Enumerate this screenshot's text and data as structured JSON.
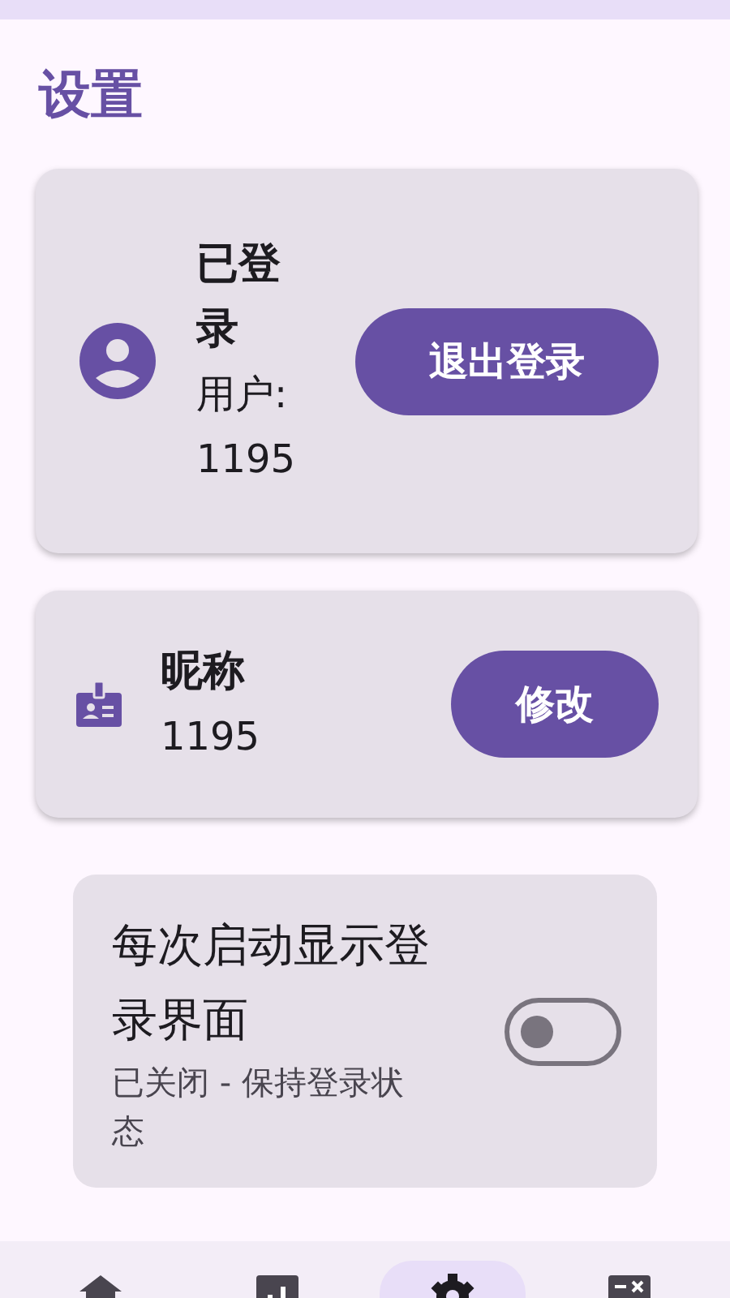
{
  "page": {
    "title": "设置"
  },
  "account": {
    "status": "已登录",
    "user": "用户: 1195",
    "button": "退出登录"
  },
  "nickname": {
    "label": "昵称",
    "value": "1195",
    "button": "修改"
  },
  "login_screen": {
    "title": "每次启动显示登录界面",
    "subtitle": "已关闭 - 保持登录状态",
    "on": false
  },
  "bottom_nav": [
    {
      "kind": "home",
      "selected": false
    },
    {
      "kind": "chart",
      "selected": false
    },
    {
      "kind": "settings",
      "selected": true
    },
    {
      "kind": "calculator",
      "selected": false
    }
  ]
}
